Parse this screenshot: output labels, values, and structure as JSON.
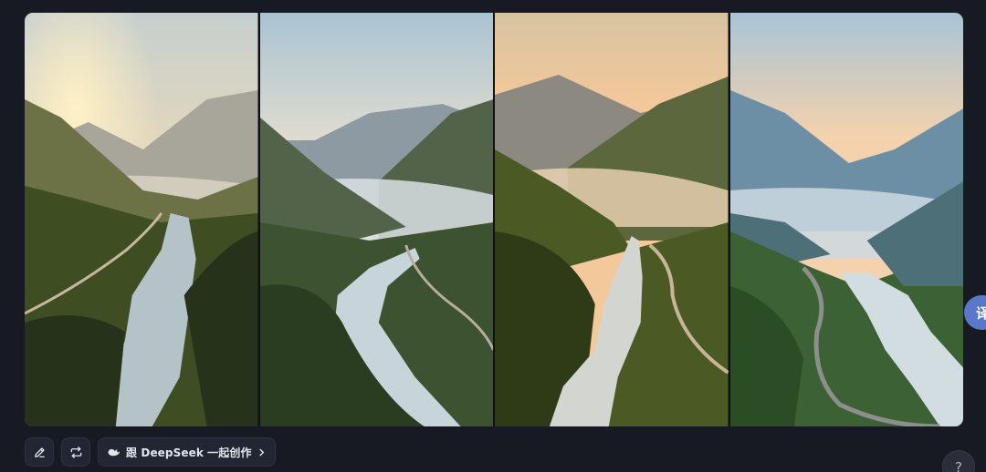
{
  "gallery": {
    "images": [
      {
        "alt": "",
        "palette": {
          "sky_top": "#c6cfcf",
          "sky_bottom": "#f2dcb2",
          "sun": "#fff1c6",
          "far": "#a8a69a",
          "mid": "#6d7246",
          "near": "#3f4d23",
          "fore": "#26331a",
          "mist": "#e3ddca",
          "river": "#b5c2c7"
        }
      },
      {
        "alt": "",
        "palette": {
          "sky_top": "#a9c3d1",
          "sky_bottom": "#e7dfd0",
          "far": "#8d9aa2",
          "mid": "#526349",
          "near": "#3d5230",
          "fore": "#2b3d21",
          "mist": "#d9e0e3",
          "river": "#c7d4da"
        }
      },
      {
        "alt": "",
        "palette": {
          "sky_top": "#d7c3a1",
          "sky_bottom": "#f3c89b",
          "far": "#8c8a80",
          "mid": "#5c673d",
          "near": "#4b5a25",
          "fore": "#2f3a17",
          "mist": "#efd6b6",
          "river": "#d3d6d0"
        }
      },
      {
        "alt": "",
        "palette": {
          "sky_top": "#a8c4d6",
          "sky_bottom": "#f3d2ad",
          "far": "#6d8fa6",
          "mid": "#4d6f77",
          "near": "#3c6135",
          "fore": "#2b4d25",
          "mist": "#cddbe3",
          "river": "#d2dde2"
        }
      }
    ]
  },
  "toolbar": {
    "edit_icon": "pencil-icon",
    "regenerate_icon": "repeat-icon",
    "collab_icon": "deepseek-whale-icon",
    "collab_label": "跟 DeepSeek 一起创作",
    "collab_chevron": "chevron-right-icon"
  },
  "side_float": {
    "label": "译"
  },
  "help": {
    "label": "?"
  }
}
